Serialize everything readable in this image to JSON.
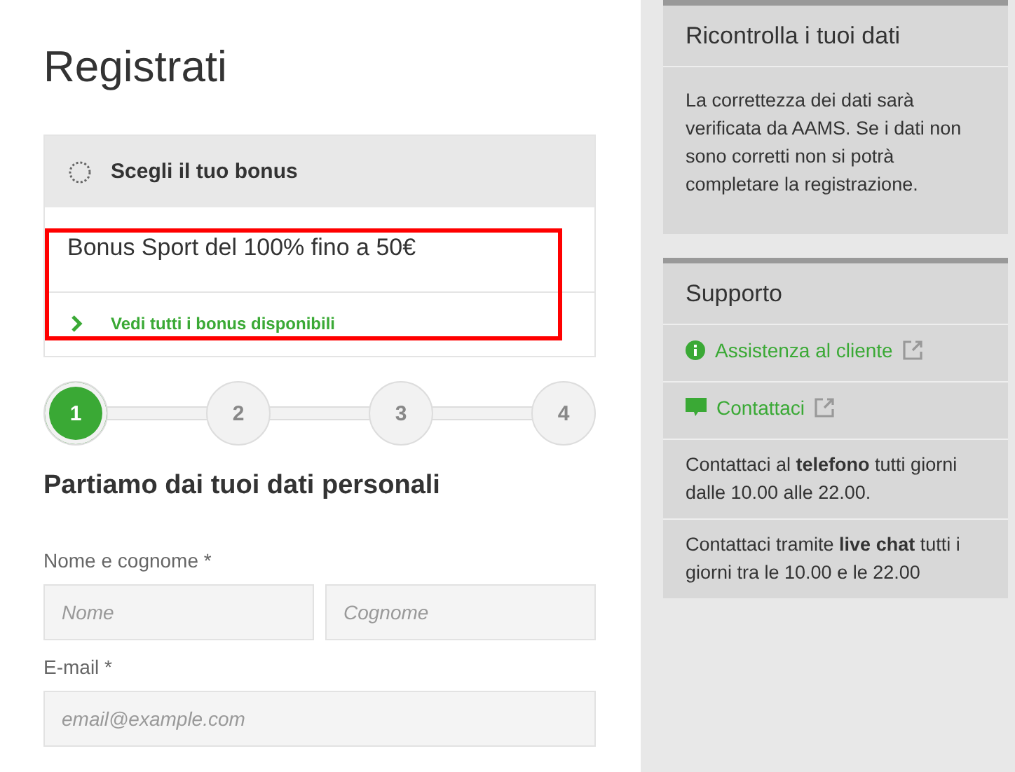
{
  "title": "Registrati",
  "bonus": {
    "header": "Scegli il tuo bonus",
    "offer": "Bonus Sport del 100% fino a 50€",
    "link": "Vedi tutti i bonus disponibili",
    "highlighted": true
  },
  "steps": [
    {
      "label": "1",
      "selected": true
    },
    {
      "label": "2",
      "selected": false
    },
    {
      "label": "3",
      "selected": false
    },
    {
      "label": "4",
      "selected": false
    }
  ],
  "section_title": "Partiamo dai tuoi dati personali",
  "form": {
    "name_label": "Nome e cognome *",
    "first_name": {
      "placeholder": "Nome"
    },
    "last_name": {
      "placeholder": "Cognome"
    },
    "email_label": "E-mail *",
    "email": {
      "placeholder": "email@example.com"
    }
  },
  "check_panel": {
    "title": "Ricontrolla i tuoi dati",
    "text": "La correttezza dei dati sarà verificata da AAMS. Se i dati non sono corretti non si potrà completare la registrazione."
  },
  "support_panel": {
    "title": "Supporto",
    "items": [
      {
        "kind": "info_link",
        "text": "Assistenza al cliente"
      },
      {
        "kind": "chat_link",
        "text": "Contattaci"
      },
      {
        "kind": "text",
        "text": "Contattaci al **telefono** tutti giorni dalle 10.00 alle 22.00."
      },
      {
        "kind": "text",
        "text": "Contattaci tramite **live chat** tutti i giorni tra le 10.00 e le 22.00"
      }
    ]
  }
}
